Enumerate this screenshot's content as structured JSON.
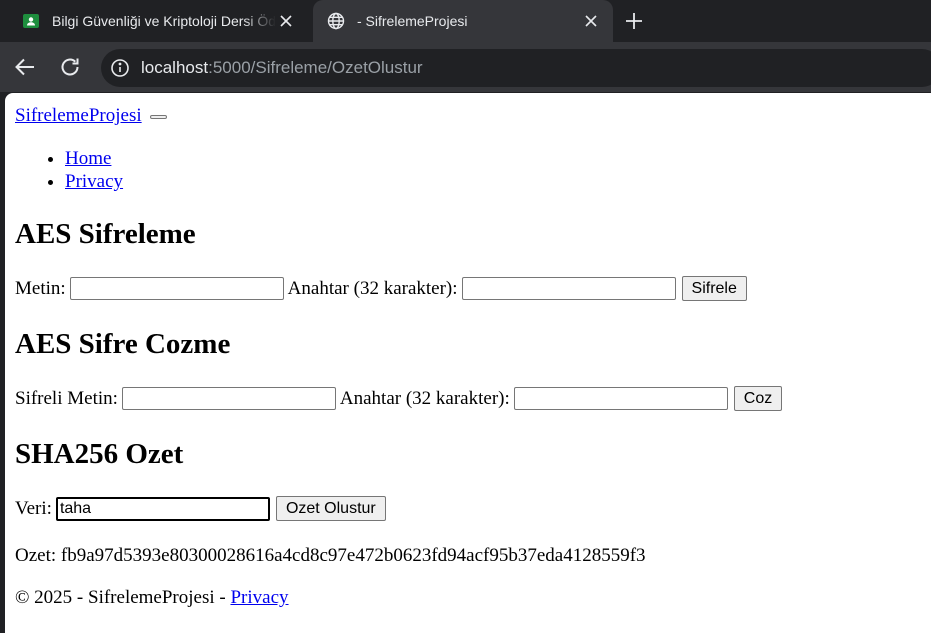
{
  "browser": {
    "tabs": [
      {
        "title": "Bilgi Güvenliği ve Kriptoloji Dersi Ödev",
        "favicon": "classroom-icon",
        "active": false
      },
      {
        "title": "- SifrelemeProjesi",
        "favicon": "globe-icon",
        "active": true
      }
    ],
    "url_host": "localhost",
    "url_path": ":5000/Sifreleme/OzetOlustur"
  },
  "page": {
    "brand": "SifrelemeProjesi",
    "nav": [
      "Home",
      "Privacy"
    ],
    "aes_encrypt": {
      "heading": "AES Sifreleme",
      "text_label": "Metin:",
      "text_value": "",
      "key_label": "Anahtar (32 karakter):",
      "key_value": "",
      "button": "Sifrele"
    },
    "aes_decrypt": {
      "heading": "AES Sifre Cozme",
      "text_label": "Sifreli Metin:",
      "text_value": "",
      "key_label": "Anahtar (32 karakter):",
      "key_value": "",
      "button": "Coz"
    },
    "sha256": {
      "heading": "SHA256 Ozet",
      "data_label": "Veri:",
      "data_value": "taha",
      "button": "Ozet Olustur",
      "result": "Ozet: fb9a97d5393e80300028616a4cd8c97e472b0623fd94acf95b37eda4128559f3"
    },
    "footer": {
      "text": "© 2025 - SifrelemeProjesi - ",
      "privacy_link": "Privacy"
    }
  },
  "colors": {
    "link": "#0000ee",
    "chrome_dark": "#202124",
    "chrome_tab": "#35363a",
    "classroom_green": "#1e8e3e"
  }
}
